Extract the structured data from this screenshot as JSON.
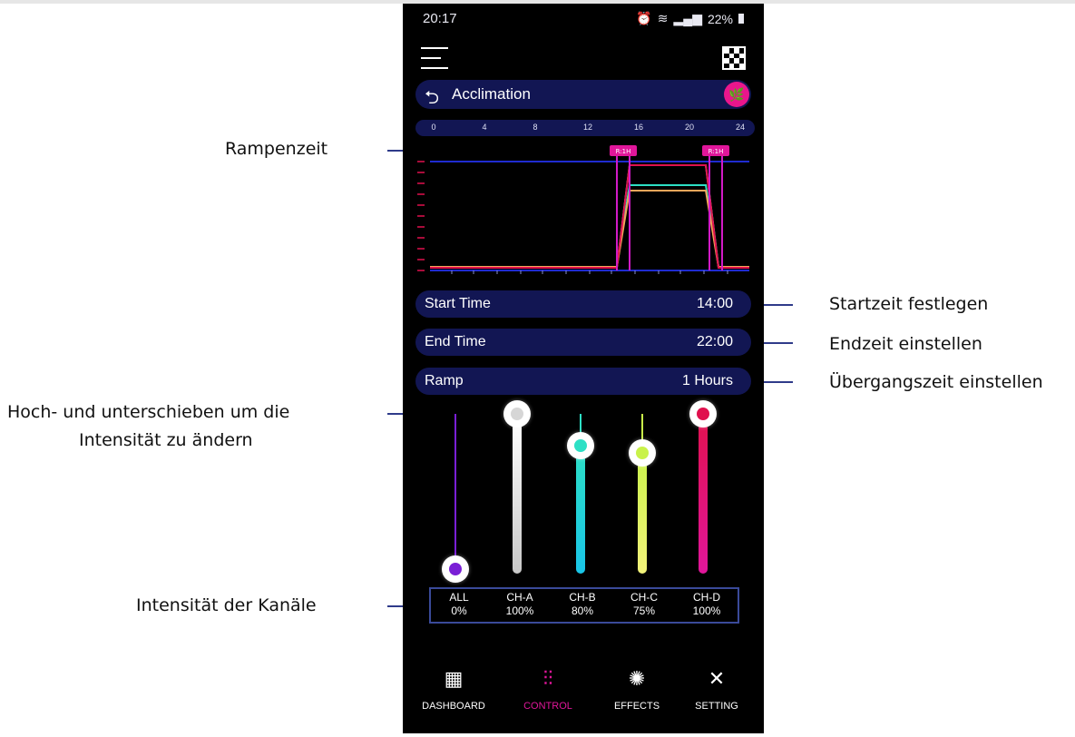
{
  "annotations": {
    "ramp_time": "Rampenzeit",
    "set_start": "Startzeit festlegen",
    "set_end": "Endzeit einstellen",
    "set_transition": "Übergangszeit einstellen",
    "slide_line1": "Hoch- und unterschieben um die",
    "slide_line2": "Intensität zu ändern",
    "channel_intensity": "Intensität der Kanäle"
  },
  "status_bar": {
    "time": "20:17",
    "battery": "22%"
  },
  "header": {
    "mode_title": "Acclimation"
  },
  "timeline": {
    "hours": [
      "0",
      "4",
      "8",
      "12",
      "16",
      "20",
      "24"
    ],
    "ramp_tag_start": "R:1H",
    "ramp_tag_end": "R:1H"
  },
  "settings": {
    "start_label": "Start Time",
    "start_value": "14:00",
    "end_label": "End Time",
    "end_value": "22:00",
    "ramp_label": "Ramp",
    "ramp_value": "1 Hours"
  },
  "channels": [
    {
      "name": "ALL",
      "value": "0%",
      "level": 0,
      "color": "#7a1fd6"
    },
    {
      "name": "CH-A",
      "value": "100%",
      "level": 1.0,
      "color": "#e6e6e6"
    },
    {
      "name": "CH-B",
      "value": "80%",
      "level": 0.8,
      "color": "#2de0c5"
    },
    {
      "name": "CH-C",
      "value": "75%",
      "level": 0.75,
      "color": "#c9f24a"
    },
    {
      "name": "CH-D",
      "value": "100%",
      "level": 1.0,
      "color": "#e0114e"
    }
  ],
  "nav": {
    "dashboard": "DASHBOARD",
    "control": "CONTROL",
    "effects": "EFFECTS",
    "setting": "SETTING",
    "active_color": "#e0169a"
  }
}
